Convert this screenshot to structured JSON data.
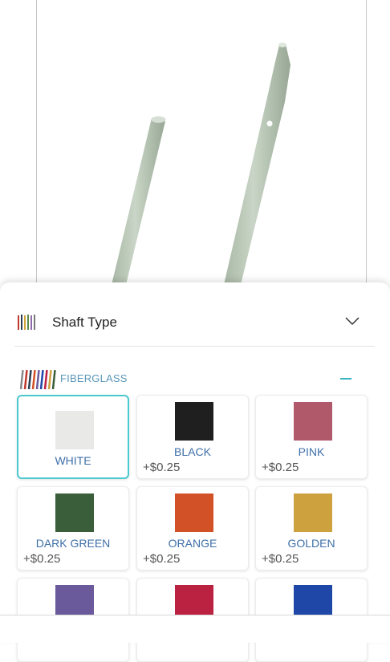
{
  "shaft_panel": {
    "title": "Shaft Type",
    "group_label": "FIBERGLASS",
    "options": [
      {
        "name": "WHITE",
        "price": "",
        "color": "#e9eae8",
        "selected": true
      },
      {
        "name": "BLACK",
        "price": "+$0.25",
        "color": "#1f1f1f",
        "selected": false
      },
      {
        "name": "PINK",
        "price": "+$0.25",
        "color": "#b0596a",
        "selected": false
      },
      {
        "name": "DARK GREEN",
        "price": "+$0.25",
        "color": "#3a5d3a",
        "selected": false
      },
      {
        "name": "ORANGE",
        "price": "+$0.25",
        "color": "#d35127",
        "selected": false
      },
      {
        "name": "GOLDEN",
        "price": "+$0.25",
        "color": "#cda13e",
        "selected": false
      },
      {
        "name": "",
        "price": "",
        "color": "#6b5a9b",
        "selected": false
      },
      {
        "name": "",
        "price": "",
        "color": "#bb2140",
        "selected": false
      },
      {
        "name": "",
        "price": "",
        "color": "#1f47a8",
        "selected": false
      }
    ]
  }
}
